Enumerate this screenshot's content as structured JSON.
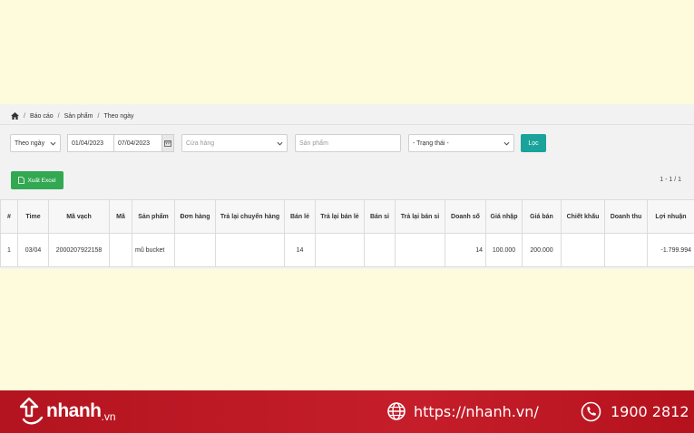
{
  "breadcrumb": {
    "items": [
      "Báo cáo",
      "Sản phẩm",
      "Theo ngày"
    ]
  },
  "filters": {
    "period": "Theo ngày",
    "date_from": "01/04/2023",
    "date_to": "07/04/2023",
    "store_placeholder": "Cửa hàng",
    "product_placeholder": "Sản phẩm",
    "status": "- Trạng thái -",
    "filter_button": "Lọc"
  },
  "toolbar": {
    "export_label": "Xuất Excel",
    "pagination": "1 - 1 / 1"
  },
  "table": {
    "headers": {
      "idx": "#",
      "time": "Time",
      "barcode": "Mã vạch",
      "code": "Mã",
      "product": "Sản phẩm",
      "order": "Đơn hàng",
      "transfer_return": "Trả lại chuyển hàng",
      "retail": "Bán lẻ",
      "retail_return": "Trả lại bán lẻ",
      "wholesale": "Bán sỉ",
      "wholesale_return": "Trả lại bán sỉ",
      "revenue_count": "Doanh số",
      "cost": "Giá nhập",
      "price": "Giá bán",
      "discount": "Chiết khấu",
      "revenue": "Doanh thu",
      "profit": "Lợi nhuận"
    },
    "row": {
      "idx": "1",
      "time": "03/04",
      "barcode": "2000207922158",
      "code": "",
      "product": "mũ bucket",
      "order": "",
      "transfer_return": "",
      "retail": "14",
      "retail_return": "",
      "wholesale": "",
      "wholesale_return": "",
      "revenue_count": "14",
      "cost": "100.000",
      "price": "200.000",
      "discount": "",
      "revenue": "",
      "profit": "-1.799.994"
    }
  },
  "footer": {
    "brand": "nhanh",
    "brand_suffix": ".vn",
    "website": "https://nhanh.vn/",
    "phone": "1900 2812"
  },
  "colors": {
    "accent": "#1aa39a",
    "excel": "#32a852",
    "footer": "#c51e2a",
    "link": "#2b7fd4"
  }
}
